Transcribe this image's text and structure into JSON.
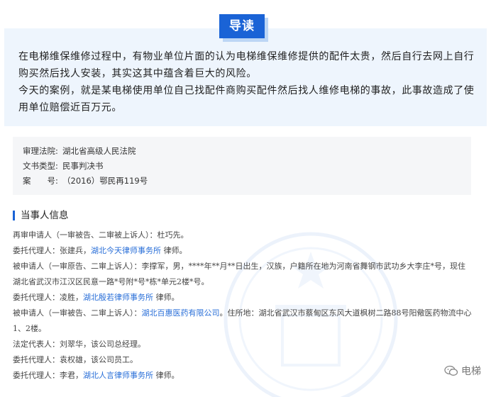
{
  "intro": {
    "badge": "导读",
    "paragraphs": [
      "在电梯维保维修过程中，有物业单位片面的认为电梯维保维修提供的配件太贵，然后自行去网上自行购买然后找人安装，其实这其中蕴含着巨大的风险。",
      "今天的案例，就是某电梯使用单位自己找配件商购买配件然后找人维修电梯的事故，此事故造成了使用单位赔偿近百万元。"
    ]
  },
  "meta": [
    {
      "key": "审理法院:",
      "value": "湖北省高级人民法院"
    },
    {
      "key": "文书类型:",
      "value": "民事判决书"
    },
    {
      "key": "案　　号:",
      "value": "（2016）鄂民再119号"
    }
  ],
  "section": {
    "title": "当事人信息"
  },
  "parties": [
    {
      "text": "再审申请人（一审被告、二审被上诉人）：杜巧先。",
      "link": "",
      "after": ""
    },
    {
      "text": "委托代理人：张建兵，",
      "link": "湖北今天律师事务所",
      "after": "律师。"
    },
    {
      "text": "被申请人（一审原告、二审上诉人）：李撑军，男，****年**月**日出生，汉族，户籍所在地为河南省舞钢市武功乡大李庄*号，现住湖北省武汉市江汉区民意一路*号附*号*栋*单元2楼*号。",
      "link": "",
      "after": ""
    },
    {
      "text": "委托代理人：凌胜，",
      "link": "湖北殷若律师事务所",
      "after": "律师。"
    },
    {
      "text": "被申请人（一审被告、二审上诉人）：",
      "link": "湖北百惠医药有限公司",
      "after": "。住所地：湖北省武汉市蔡甸区东风大道枫树二路88号阳儆医药物流中心1、2楼。"
    },
    {
      "text": "法定代表人：刘翠华，该公司总经理。",
      "link": "",
      "after": ""
    },
    {
      "text": "委托代理人：袁权雄，该公司员工。",
      "link": "",
      "after": ""
    },
    {
      "text": "委托代理人：李君，",
      "link": "湖北人言律师事务所",
      "after": "律师。"
    }
  ],
  "logo": {
    "text": "电梯",
    "icon": "wechat-icon"
  },
  "colors": {
    "accent": "#1a63d6",
    "intro_bg": "#eef5fd",
    "meta_bg": "#f5f6f8",
    "link": "#2a6fd8"
  }
}
